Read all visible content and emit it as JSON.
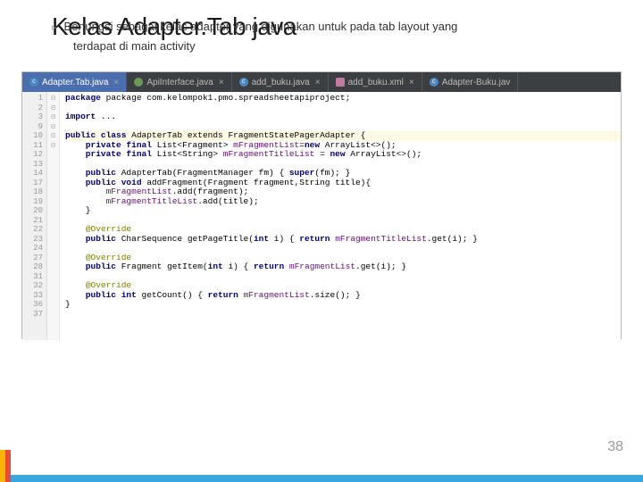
{
  "slide": {
    "title": "Kelas Adapter.Tab java",
    "bullet": "Berfungsi sebagai kelas adapter yang digunakan untuk pada tab layout yang",
    "bullet2": "terdapat di main activity",
    "pagenum": "38"
  },
  "tabs": [
    {
      "label": "Adapter.Tab.java",
      "icon": "c",
      "active": true
    },
    {
      "label": "ApiInterface.java",
      "icon": "i",
      "active": false
    },
    {
      "label": "add_buku.java",
      "icon": "c",
      "active": false
    },
    {
      "label": "add_buku.xml",
      "icon": "xml",
      "active": false
    },
    {
      "label": "Adapter-Buku.jav",
      "icon": "c",
      "active": false
    }
  ],
  "gutter": [
    "1",
    "2",
    "3",
    "9",
    "",
    "10",
    "11",
    "12",
    "13",
    "14",
    "17",
    "18",
    "19",
    "20",
    "21",
    "22",
    "23",
    "24",
    "27",
    "28",
    "31",
    "32",
    "33",
    "36",
    "37"
  ],
  "fold": [
    "",
    "",
    "",
    "",
    "",
    "⊟",
    "",
    "",
    "",
    "⊟",
    "",
    "",
    "",
    "⊟",
    "",
    "",
    "",
    "⊟",
    "",
    "⊟",
    "",
    "",
    "⊟",
    "",
    ""
  ],
  "code": {
    "l1": "package com.kelompok1.pmo.spreadsheetapiproject;",
    "l3": "import ...",
    "l10a": "public class ",
    "l10b": "AdapterTab",
    "l10c": " extends FragmentStatePagerAdapter {",
    "l11": "    private final List<Fragment> mFragmentList=new ArrayList<>();",
    "l12": "    private final List<String> mFragmentTitleList = new ArrayList<>();",
    "l14": "    public AdapterTab(FragmentManager fm) { super(fm); }",
    "l17": "    public void addFragment(Fragment fragment,String title){",
    "l18": "        mFragmentList.add(fragment);",
    "l19": "        mFragmentTitleList.add(title);",
    "l20": "    }",
    "l22": "    @Override",
    "l23": "    public CharSequence getPageTitle(int i) { return mFragmentTitleList.get(i); }",
    "l27": "    @Override",
    "l28": "    public Fragment getItem(int i) { return mFragmentList.get(i); }",
    "l32": "    @Override",
    "l33": "    public int getCount() { return mFragmentList.size(); }",
    "l36": "}"
  }
}
